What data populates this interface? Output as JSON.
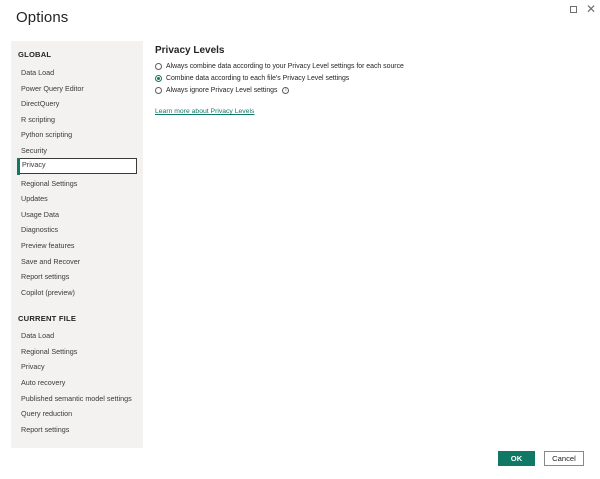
{
  "window": {
    "title": "Options",
    "maximize_icon": "maximize-icon",
    "close_icon": "close-icon",
    "close_glyph": "✕"
  },
  "sidebar": {
    "global_header": "GLOBAL",
    "global_items": [
      {
        "label": "Data Load"
      },
      {
        "label": "Power Query Editor"
      },
      {
        "label": "DirectQuery"
      },
      {
        "label": "R scripting"
      },
      {
        "label": "Python scripting"
      },
      {
        "label": "Security"
      },
      {
        "label": "Privacy",
        "selected": true
      },
      {
        "label": "Regional Settings"
      },
      {
        "label": "Updates"
      },
      {
        "label": "Usage Data"
      },
      {
        "label": "Diagnostics"
      },
      {
        "label": "Preview features"
      },
      {
        "label": "Save and Recover"
      },
      {
        "label": "Report settings"
      },
      {
        "label": "Copilot (preview)"
      }
    ],
    "current_header": "CURRENT FILE",
    "current_items": [
      {
        "label": "Data Load"
      },
      {
        "label": "Regional Settings"
      },
      {
        "label": "Privacy"
      },
      {
        "label": "Auto recovery"
      },
      {
        "label": "Published semantic model settings"
      },
      {
        "label": "Query reduction"
      },
      {
        "label": "Report settings"
      }
    ]
  },
  "main": {
    "heading": "Privacy Levels",
    "options": [
      {
        "label": "Always combine data according to your Privacy Level settings for each source",
        "checked": false
      },
      {
        "label": "Combine data according to each file's Privacy Level settings",
        "checked": true
      },
      {
        "label": "Always ignore Privacy Level settings",
        "checked": false,
        "info_icon": "info-icon",
        "info_glyph": "i"
      }
    ],
    "learn_more": "Learn more about Privacy Levels"
  },
  "footer": {
    "ok_label": "OK",
    "cancel_label": "Cancel"
  },
  "colors": {
    "accent": "#117865",
    "sidebar_bg": "#f3f2f1",
    "text": "#252423"
  }
}
